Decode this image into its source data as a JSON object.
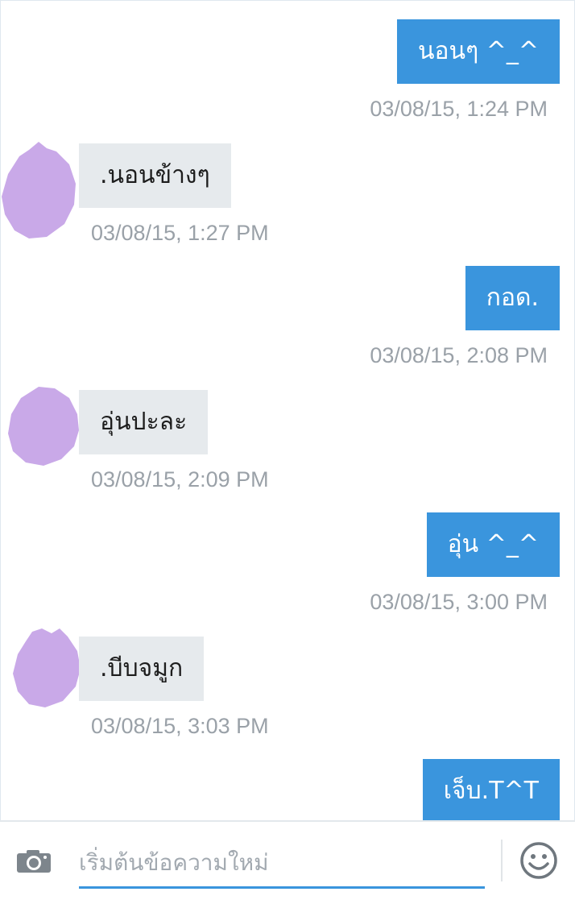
{
  "messages": [
    {
      "direction": "out",
      "text": "นอนๆ ^_^",
      "time": "03/08/15, 1:24 PM"
    },
    {
      "direction": "in",
      "text": ".นอนข้างๆ",
      "time": "03/08/15, 1:27 PM"
    },
    {
      "direction": "out",
      "text": "กอด.",
      "time": "03/08/15, 2:08 PM"
    },
    {
      "direction": "in",
      "text": "อุ่นปะละ",
      "time": "03/08/15, 2:09 PM"
    },
    {
      "direction": "out",
      "text": "อุ่น ^_^",
      "time": "03/08/15, 3:00 PM"
    },
    {
      "direction": "in",
      "text": ".บีบจมูก",
      "time": "03/08/15, 3:03 PM"
    },
    {
      "direction": "out",
      "text": "เจ็บ.T^T",
      "time": ""
    }
  ],
  "composer": {
    "placeholder": "เริ่มต้นข้อความใหม่",
    "value": "",
    "camera_icon": "camera-icon",
    "emoji_icon": "smiley-icon"
  },
  "colors": {
    "outgoing_bubble": "#3a95dd",
    "incoming_bubble": "#e6eaed",
    "timestamp": "#9aa1a8",
    "avatar": "#c9a9e8",
    "accent": "#3a95dd"
  }
}
